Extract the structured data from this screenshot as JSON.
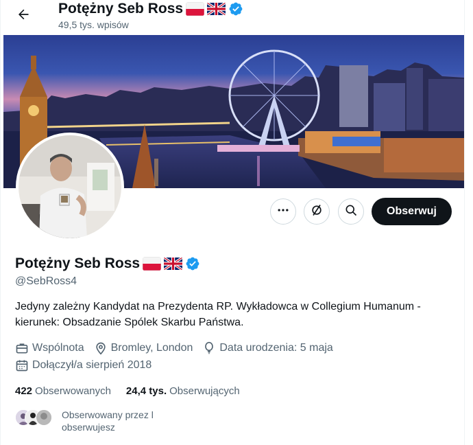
{
  "header": {
    "name": "Potężny Seb Ross",
    "posts_count": "49,5 tys. wpisów",
    "back_icon": "arrow-left-icon"
  },
  "actions": {
    "more_icon": "more-dots-icon",
    "grok_icon": "grok-icon",
    "search_icon": "search-icon",
    "follow_label": "Obserwuj"
  },
  "profile": {
    "name": "Potężny Seb Ross",
    "handle": "@SebRoss4",
    "bio": "Jedyny zależny Kandydat na Prezydenta RP.  Wykładowca w Collegium Humanum - kierunek: Obsadzanie Spólek Skarbu Państwa.",
    "category": "Wspólnota",
    "location": "Bromley, London",
    "birthday": "Data urodzenia: 5 maja",
    "joined": "Dołączył/a sierpień 2018",
    "verified_color": "#1d9bf0"
  },
  "stats": {
    "following_count": "422",
    "following_label": "Obserwowanych",
    "followers_count": "24,4 tys.",
    "followers_label": "Obserwujących"
  },
  "followed_by": {
    "text": "Obserwowany przez l obserwujesz"
  },
  "colors": {
    "accent": "#0f1419",
    "secondary_text": "#536471",
    "verified": "#1d9bf0"
  }
}
